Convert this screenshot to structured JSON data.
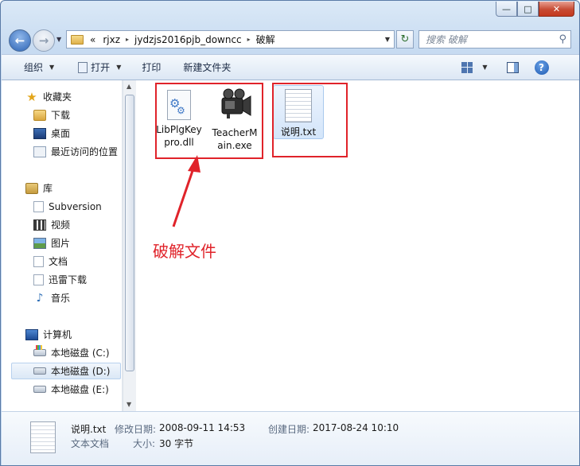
{
  "window": {
    "min_glyph": "—",
    "max_glyph": "□",
    "close_glyph": "✕"
  },
  "address": {
    "chevrons": "«",
    "segments": [
      "rjxz",
      "jydzjs2016pjb_downcc",
      "破解"
    ],
    "separator": "▸"
  },
  "search": {
    "placeholder": "搜索 破解"
  },
  "toolbar": {
    "organize": "组织",
    "open": "打开",
    "print": "打印",
    "new_folder": "新建文件夹",
    "help": "?"
  },
  "sidebar": {
    "favorites": {
      "label": "收藏夹",
      "items": [
        "下载",
        "桌面",
        "最近访问的位置"
      ]
    },
    "library": {
      "label": "库",
      "items": [
        "Subversion",
        "视频",
        "图片",
        "文档",
        "迅雷下载",
        "音乐"
      ]
    },
    "computer": {
      "label": "计算机",
      "items": [
        "本地磁盘 (C:)",
        "本地磁盘 (D:)",
        "本地磁盘 (E:)"
      ],
      "selected": "本地磁盘 (D:)"
    }
  },
  "files": [
    {
      "name": "LibPlgKeypro.dll",
      "line1": "LibPlgKey",
      "line2": "pro.dll",
      "icon": "dll-gear-icon"
    },
    {
      "name": "TeacherMain.exe",
      "line1": "TeacherM",
      "line2": "ain.exe",
      "icon": "video-camera-icon"
    },
    {
      "name": "说明.txt",
      "line1": "说明.txt",
      "line2": "",
      "icon": "text-document-icon",
      "selected": true
    }
  ],
  "annotation": {
    "text": "破解文件",
    "color": "#e0232a"
  },
  "details": {
    "filename": "说明.txt",
    "type": "文本文档",
    "modified_label": "修改日期:",
    "modified_value": "2008-09-11 14:53",
    "created_label": "创建日期:",
    "created_value": "2017-08-24 10:10",
    "size_label": "大小:",
    "size_value": "30 字节"
  }
}
